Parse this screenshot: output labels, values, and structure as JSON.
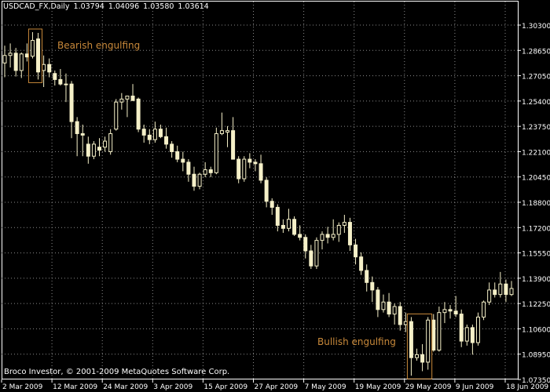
{
  "header": {
    "symbol": "USDCAD_FX,Daily",
    "open": "1.03794",
    "high": "1.04096",
    "low": "1.03580",
    "close": "1.03614"
  },
  "footer": {
    "copyright": "Broco Investor, © 2001-2009 MetaQuotes Software Corp."
  },
  "annotations": {
    "bearish": "Bearish engulfing",
    "bullish": "Bullish engulfing"
  },
  "colors": {
    "background": "#000000",
    "candle": "#f5f0c8",
    "grid": "#8a8a8a",
    "annotation": "#c8893a",
    "axis": "#ffffff"
  },
  "chart_data": {
    "type": "candlestick",
    "ylim": [
      1.0735,
      1.3165
    ],
    "y_ticks": [
      "1.30300",
      "1.28650",
      "1.27050",
      "1.25400",
      "1.23750",
      "1.22100",
      "1.20450",
      "1.18800",
      "1.17200",
      "1.15550",
      "1.13900",
      "1.12250",
      "1.10600",
      "1.08950",
      "1.07350"
    ],
    "x_ticks": [
      "2 Mar 2009",
      "12 Mar 2009",
      "24 Mar 2009",
      "3 Apr 2009",
      "15 Apr 2009",
      "27 Apr 2009",
      "7 May 2009",
      "19 May 2009",
      "29 May 2009",
      "9 Jun 2009",
      "18 Jun 2009"
    ],
    "ohlc": [
      [
        1.284,
        1.2955,
        1.2745,
        1.289
      ],
      [
        1.289,
        1.297,
        1.281,
        1.2905
      ],
      [
        1.2905,
        1.294,
        1.275,
        1.279
      ],
      [
        1.279,
        1.291,
        1.274,
        1.29
      ],
      [
        1.29,
        1.297,
        1.285,
        1.288
      ],
      [
        1.2885,
        1.3045,
        1.287,
        1.299
      ],
      [
        1.3,
        1.304,
        1.273,
        1.278
      ],
      [
        1.279,
        1.289,
        1.268,
        1.283
      ],
      [
        1.283,
        1.287,
        1.2745,
        1.278
      ],
      [
        1.277,
        1.279,
        1.269,
        1.273
      ],
      [
        1.273,
        1.28,
        1.269,
        1.27
      ],
      [
        1.27,
        1.277,
        1.258,
        1.27
      ],
      [
        1.27,
        1.272,
        1.234,
        1.245
      ],
      [
        1.245,
        1.248,
        1.222,
        1.237
      ],
      [
        1.237,
        1.243,
        1.222,
        1.236
      ],
      [
        1.23,
        1.235,
        1.217,
        1.222
      ],
      [
        1.222,
        1.232,
        1.22,
        1.23
      ],
      [
        1.228,
        1.234,
        1.222,
        1.226
      ],
      [
        1.228,
        1.235,
        1.225,
        1.232
      ],
      [
        1.225,
        1.24,
        1.223,
        1.237
      ],
      [
        1.24,
        1.26,
        1.239,
        1.258
      ],
      [
        1.258,
        1.264,
        1.253,
        1.26
      ],
      [
        1.26,
        1.262,
        1.248,
        1.262
      ],
      [
        1.262,
        1.27,
        1.259,
        1.259
      ],
      [
        1.26,
        1.261,
        1.238,
        1.24
      ],
      [
        1.24,
        1.243,
        1.231,
        1.236
      ],
      [
        1.236,
        1.24,
        1.23,
        1.233
      ],
      [
        1.233,
        1.245,
        1.231,
        1.24
      ],
      [
        1.24,
        1.243,
        1.234,
        1.235
      ],
      [
        1.235,
        1.241,
        1.227,
        1.23
      ],
      [
        1.23,
        1.232,
        1.221,
        1.225
      ],
      [
        1.225,
        1.229,
        1.218,
        1.22
      ],
      [
        1.22,
        1.225,
        1.212,
        1.218
      ],
      [
        1.218,
        1.22,
        1.205,
        1.21
      ],
      [
        1.21,
        1.215,
        1.199,
        1.202
      ],
      [
        1.202,
        1.211,
        1.2,
        1.21
      ],
      [
        1.21,
        1.218,
        1.208,
        1.213
      ],
      [
        1.213,
        1.215,
        1.208,
        1.211
      ],
      [
        1.211,
        1.241,
        1.21,
        1.237
      ],
      [
        1.237,
        1.251,
        1.236,
        1.239
      ],
      [
        1.238,
        1.242,
        1.228,
        1.239
      ],
      [
        1.239,
        1.248,
        1.231,
        1.22
      ],
      [
        1.22,
        1.222,
        1.204,
        1.207
      ],
      [
        1.207,
        1.222,
        1.205,
        1.22
      ],
      [
        1.22,
        1.224,
        1.214,
        1.218
      ],
      [
        1.218,
        1.22,
        1.212,
        1.217
      ],
      [
        1.217,
        1.223,
        1.204,
        1.206
      ],
      [
        1.206,
        1.208,
        1.188,
        1.192
      ],
      [
        1.192,
        1.194,
        1.183,
        1.188
      ],
      [
        1.188,
        1.19,
        1.172,
        1.176
      ],
      [
        1.176,
        1.18,
        1.171,
        1.174
      ],
      [
        1.174,
        1.187,
        1.172,
        1.18
      ],
      [
        1.18,
        1.182,
        1.169,
        1.17
      ],
      [
        1.17,
        1.176,
        1.166,
        1.168
      ],
      [
        1.168,
        1.17,
        1.154,
        1.159
      ],
      [
        1.159,
        1.163,
        1.147,
        1.149
      ],
      [
        1.149,
        1.168,
        1.147,
        1.166
      ],
      [
        1.166,
        1.172,
        1.16,
        1.17
      ],
      [
        1.17,
        1.175,
        1.164,
        1.168
      ],
      [
        1.168,
        1.18,
        1.166,
        1.17
      ],
      [
        1.17,
        1.178,
        1.165,
        1.176
      ],
      [
        1.176,
        1.183,
        1.171,
        1.178
      ],
      [
        1.178,
        1.181,
        1.159,
        1.163
      ],
      [
        1.163,
        1.167,
        1.15,
        1.155
      ],
      [
        1.155,
        1.158,
        1.143,
        1.146
      ],
      [
        1.146,
        1.15,
        1.132,
        1.138
      ],
      [
        1.138,
        1.142,
        1.125,
        1.133
      ],
      [
        1.133,
        1.135,
        1.115,
        1.12
      ],
      [
        1.12,
        1.13,
        1.118,
        1.125
      ],
      [
        1.125,
        1.131,
        1.115,
        1.117
      ],
      [
        1.117,
        1.124,
        1.11,
        1.122
      ],
      [
        1.122,
        1.125,
        1.106,
        1.11
      ],
      [
        1.11,
        1.118,
        1.105,
        1.112
      ],
      [
        1.112,
        1.115,
        1.076,
        1.088
      ],
      [
        1.088,
        1.094,
        1.086,
        1.09
      ],
      [
        1.09,
        1.097,
        1.079,
        1.085
      ],
      [
        1.085,
        1.115,
        1.08,
        1.113
      ],
      [
        1.113,
        1.117,
        1.092,
        1.093
      ],
      [
        1.093,
        1.122,
        1.092,
        1.118
      ],
      [
        1.118,
        1.125,
        1.111,
        1.12
      ],
      [
        1.12,
        1.123,
        1.114,
        1.119
      ],
      [
        1.119,
        1.129,
        1.115,
        1.117
      ],
      [
        1.117,
        1.12,
        1.095,
        1.099
      ],
      [
        1.099,
        1.11,
        1.096,
        1.108
      ],
      [
        1.108,
        1.11,
        1.09,
        1.098
      ],
      [
        1.098,
        1.118,
        1.096,
        1.115
      ],
      [
        1.115,
        1.126,
        1.113,
        1.125
      ],
      [
        1.125,
        1.138,
        1.123,
        1.133
      ],
      [
        1.133,
        1.138,
        1.128,
        1.13
      ],
      [
        1.13,
        1.145,
        1.128,
        1.137
      ],
      [
        1.137,
        1.14,
        1.125,
        1.13
      ],
      [
        1.13,
        1.139,
        1.129,
        1.134
      ]
    ]
  }
}
